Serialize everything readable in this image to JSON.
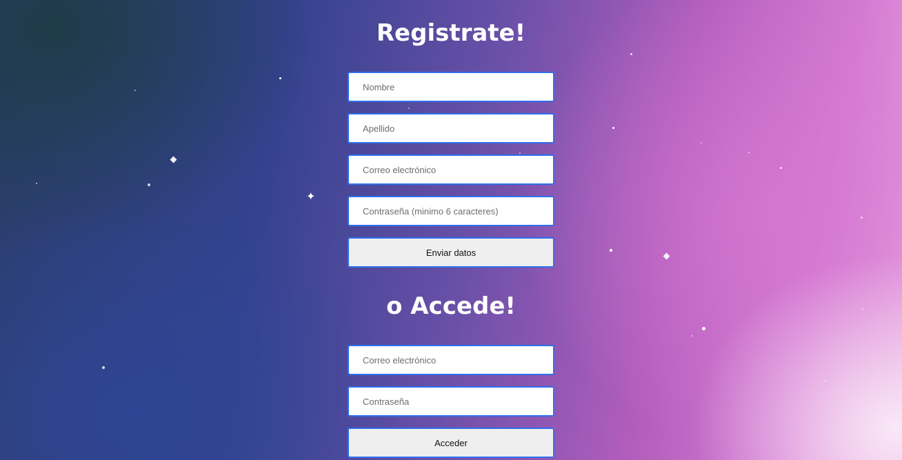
{
  "register": {
    "title": "Registrate!",
    "first_name_placeholder": "Nombre",
    "last_name_placeholder": "Apellido",
    "email_placeholder": "Correo electrónico",
    "password_placeholder": "Contraseña (minimo 6 caracteres)",
    "submit_label": "Enviar datos"
  },
  "login": {
    "title": "o Accede!",
    "email_placeholder": "Correo electrónico",
    "password_placeholder": "Contraseña",
    "submit_label": "Acceder"
  },
  "colors": {
    "field_border": "#2f6fed",
    "button_bg": "#efefef",
    "heading_text": "#ffffff"
  }
}
